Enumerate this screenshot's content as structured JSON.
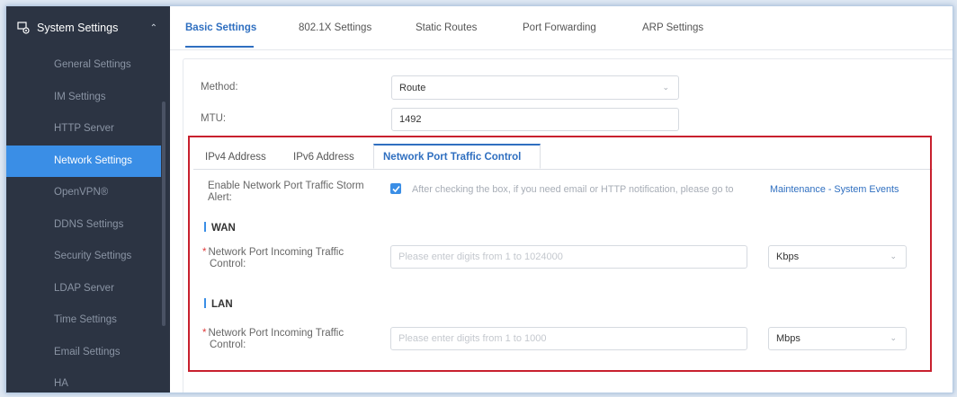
{
  "sidebar": {
    "header": "System Settings",
    "items": [
      {
        "label": "General Settings",
        "active": false
      },
      {
        "label": "IM Settings",
        "active": false
      },
      {
        "label": "HTTP Server",
        "active": false
      },
      {
        "label": "Network Settings",
        "active": true
      },
      {
        "label": "OpenVPN®",
        "active": false
      },
      {
        "label": "DDNS Settings",
        "active": false
      },
      {
        "label": "Security Settings",
        "active": false
      },
      {
        "label": "LDAP Server",
        "active": false
      },
      {
        "label": "Time Settings",
        "active": false
      },
      {
        "label": "Email Settings",
        "active": false
      },
      {
        "label": "HA",
        "active": false
      }
    ]
  },
  "tabs": [
    {
      "label": "Basic Settings",
      "active": true
    },
    {
      "label": "802.1X Settings",
      "active": false
    },
    {
      "label": "Static Routes",
      "active": false
    },
    {
      "label": "Port Forwarding",
      "active": false
    },
    {
      "label": "ARP Settings",
      "active": false
    }
  ],
  "form": {
    "method_label": "Method:",
    "method_value": "Route",
    "mtu_label": "MTU:",
    "mtu_value": "1492"
  },
  "inner_tabs": [
    {
      "label": "IPv4 Address",
      "active": false
    },
    {
      "label": "IPv6 Address",
      "active": false
    },
    {
      "label": "Network Port Traffic Control",
      "active": true
    }
  ],
  "storm": {
    "label_line1": "Enable Network Port Traffic Storm",
    "label_line2": "Alert:",
    "checked": true,
    "note": "After checking the box, if you need email or HTTP notification, please go to",
    "link": "Maintenance - System Events"
  },
  "wan": {
    "title": "WAN",
    "label_line1": "Network Port Incoming Traffic",
    "label_line2": "Control:",
    "placeholder": "Please enter digits from 1 to 1024000",
    "unit": "Kbps"
  },
  "lan": {
    "title": "LAN",
    "label_line1": "Network Port Incoming Traffic",
    "label_line2": "Control:",
    "placeholder": "Please enter digits from 1 to 1000",
    "unit": "Mbps"
  },
  "colors": {
    "accent": "#2f6fc0",
    "sidebar_bg": "#2c3443",
    "active_item": "#3a8ee6",
    "highlight_frame": "#c8202e"
  }
}
